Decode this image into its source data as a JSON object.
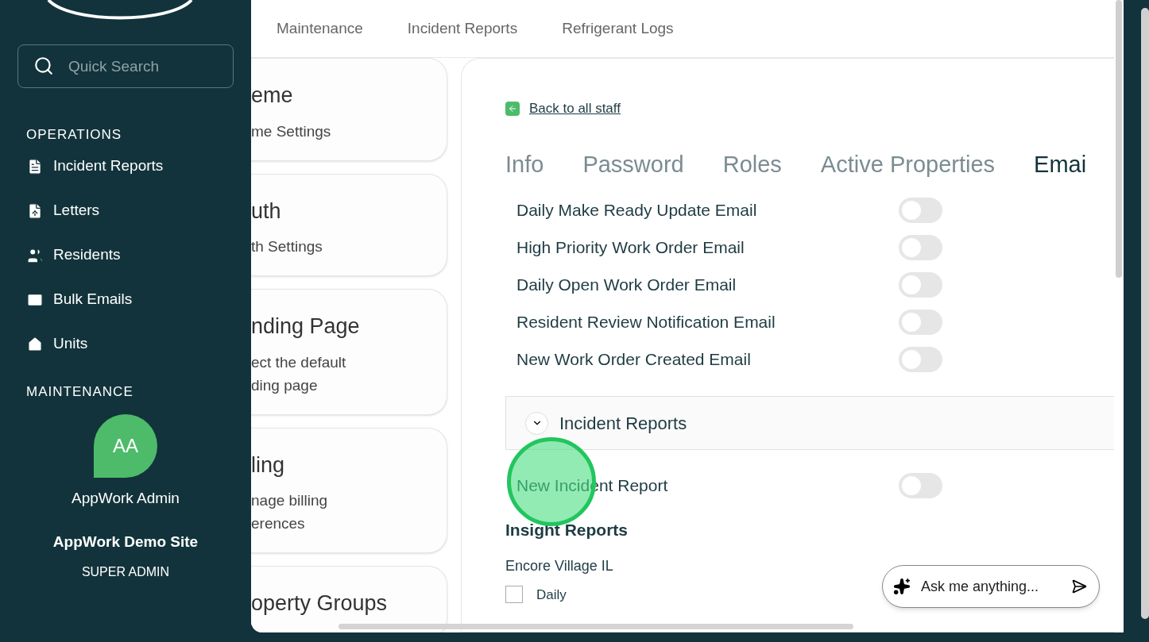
{
  "sidebar": {
    "search": {
      "placeholder": "Quick Search"
    },
    "sections": [
      {
        "title": "OPERATIONS",
        "items": [
          {
            "label": "Incident Reports"
          },
          {
            "label": "Letters"
          },
          {
            "label": "Residents"
          },
          {
            "label": "Bulk Emails"
          },
          {
            "label": "Units"
          }
        ]
      },
      {
        "title": "MAINTENANCE"
      }
    ],
    "user": {
      "initials": "AA",
      "name": "AppWork Admin",
      "site": "AppWork Demo Site",
      "role": "SUPER ADMIN"
    }
  },
  "top_nav": [
    "Maintenance",
    "Incident Reports",
    "Refrigerant Logs"
  ],
  "settings_cards": [
    {
      "title": "eme",
      "lines": [
        "me Settings"
      ]
    },
    {
      "title": "uth",
      "lines": [
        "th Settings"
      ]
    },
    {
      "title": "nding Page",
      "lines": [
        "ect the default",
        "ding page"
      ]
    },
    {
      "title": "ling",
      "lines": [
        "nage billing",
        "erences"
      ]
    },
    {
      "title": "operty Groups"
    }
  ],
  "detail": {
    "back_link": "Back to all staff",
    "tabs": [
      {
        "label": "Info",
        "selected": false
      },
      {
        "label": "Password",
        "selected": false
      },
      {
        "label": "Roles",
        "selected": false
      },
      {
        "label": "Active Properties",
        "selected": false
      },
      {
        "label": "Emai",
        "selected": true
      }
    ],
    "toggles": [
      {
        "label": "Daily Make Ready Update Email",
        "on": false
      },
      {
        "label": "High Priority Work Order Email",
        "on": false
      },
      {
        "label": "Daily Open Work Order Email",
        "on": false
      },
      {
        "label": "Resident Review Notification Email",
        "on": false
      },
      {
        "label": "New Work Order Created Email",
        "on": false
      }
    ],
    "section": {
      "title": "Incident Reports",
      "expanded": true,
      "toggles": [
        {
          "label": "New Incident Report",
          "on": false
        }
      ]
    },
    "insight": {
      "title": "Insight Reports",
      "property": "Encore Village IL",
      "options": [
        {
          "label": "Daily",
          "checked": false
        }
      ]
    }
  },
  "chat": {
    "placeholder": "Ask me anything..."
  }
}
